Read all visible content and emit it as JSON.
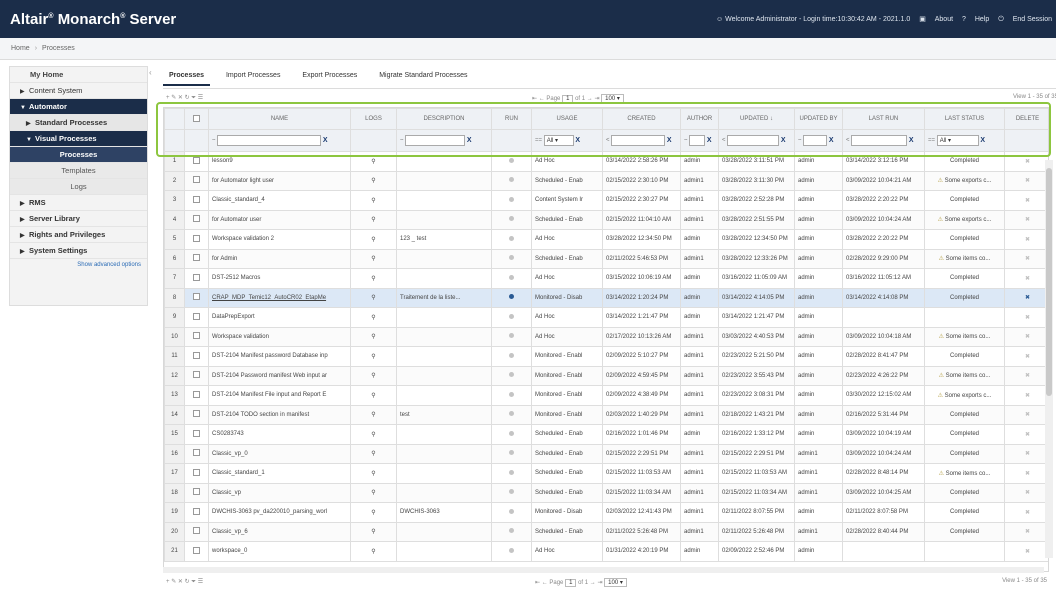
{
  "header": {
    "brand": "Altair",
    "brand_mark": "®",
    "brand_middle": "Monarch",
    "brand_tail": "Server",
    "welcome": "Welcome Administrator - Login time:10:30:42 AM - 2021.1.0",
    "about": "About",
    "help": "Help",
    "end_session": "End Session"
  },
  "breadcrumb": {
    "home": "Home",
    "current": "Processes"
  },
  "sidebar": {
    "home": "My Home",
    "content_system": "Content System",
    "automator": "Automator",
    "standard_processes": "Standard Processes",
    "visual_processes": "Visual Processes",
    "processes": "Processes",
    "templates": "Templates",
    "logs": "Logs",
    "rms": "RMS",
    "server_library": "Server Library",
    "rights": "Rights and Privileges",
    "system_settings": "System Settings",
    "advanced": "Show advanced options"
  },
  "tabs": {
    "processes": "Processes",
    "import": "Import Processes",
    "export": "Export Processes",
    "migrate": "Migrate Standard Processes"
  },
  "pager": {
    "page_label": "Page",
    "page": "1",
    "of": "of 1",
    "page_size": "100",
    "view": "View 1 - 35 of 35"
  },
  "columns": {
    "name": "NAME",
    "logs": "LOGS",
    "description": "DESCRIPTION",
    "run": "RUN",
    "usage": "USAGE",
    "created": "CREATED",
    "author": "AUTHOR",
    "updated": "UPDATED",
    "updated_by": "UPDATED BY",
    "last_run": "LAST RUN",
    "last_status": "LAST STATUS",
    "delete": "DELETE"
  },
  "filters": {
    "all": "All",
    "clear": "X",
    "op_tilde": "~",
    "op_eq": "==",
    "op_lt": "<"
  },
  "rows": [
    {
      "num": "1",
      "name": "lesson9",
      "desc": "",
      "usage": "Ad Hoc",
      "created": "03/14/2022 2:58:26 PM",
      "author": "admin",
      "updated": "03/28/2022 3:11:51 PM",
      "updated_by": "admin",
      "last_run": "03/14/2022 3:12:16 PM",
      "status": "Completed",
      "warn": false
    },
    {
      "num": "2",
      "name": "for Automator light user",
      "desc": "",
      "usage": "Scheduled - Enab",
      "created": "02/15/2022 2:30:10 PM",
      "author": "admin1",
      "updated": "03/28/2022 3:11:30 PM",
      "updated_by": "admin",
      "last_run": "03/09/2022 10:04:21 AM",
      "status": "Some exports c...",
      "warn": true
    },
    {
      "num": "3",
      "name": "Classic_standard_4",
      "desc": "",
      "usage": "Content System Ir",
      "created": "02/15/2022 2:30:27 PM",
      "author": "admin1",
      "updated": "03/28/2022 2:52:28 PM",
      "updated_by": "admin",
      "last_run": "03/28/2022 2:20:22 PM",
      "status": "Completed",
      "warn": false
    },
    {
      "num": "4",
      "name": "for Automator user",
      "desc": "",
      "usage": "Scheduled - Enab",
      "created": "02/15/2022 11:04:10 AM",
      "author": "admin1",
      "updated": "03/28/2022 2:51:55 PM",
      "updated_by": "admin",
      "last_run": "03/09/2022 10:04:24 AM",
      "status": "Some exports c...",
      "warn": true
    },
    {
      "num": "5",
      "name": "Workspace validation 2",
      "desc": "123 _ test",
      "usage": "Ad Hoc",
      "created": "03/28/2022 12:34:50 PM",
      "author": "admin",
      "updated": "03/28/2022 12:34:50 PM",
      "updated_by": "admin",
      "last_run": "03/28/2022 2:20:22 PM",
      "status": "Completed",
      "warn": false
    },
    {
      "num": "6",
      "name": "for Admin",
      "desc": "",
      "usage": "Scheduled - Enab",
      "created": "02/11/2022 5:46:53 PM",
      "author": "admin1",
      "updated": "03/28/2022 12:33:26 PM",
      "updated_by": "admin",
      "last_run": "02/28/2022 9:29:00 PM",
      "status": "Some items co...",
      "warn": true
    },
    {
      "num": "7",
      "name": "DST-2512 Macros",
      "desc": "",
      "usage": "Ad Hoc",
      "created": "03/15/2022 10:06:19 AM",
      "author": "admin",
      "updated": "03/16/2022 11:05:09 AM",
      "updated_by": "admin",
      "last_run": "03/16/2022 11:05:12 AM",
      "status": "Completed",
      "warn": false
    },
    {
      "num": "8",
      "name": "CRAP_MDP_Temic12_AutoCR02_EtapMe",
      "desc": "Traitement de la liste...",
      "usage": "Monitored - Disab",
      "created": "03/14/2022 1:20:24 PM",
      "author": "admin",
      "updated": "03/14/2022 4:14:05 PM",
      "updated_by": "admin",
      "last_run": "03/14/2022 4:14:08 PM",
      "status": "Completed",
      "warn": false,
      "selected": true
    },
    {
      "num": "9",
      "name": "DataPrepExport",
      "desc": "",
      "usage": "Ad Hoc",
      "created": "03/14/2022 1:21:47 PM",
      "author": "admin",
      "updated": "03/14/2022 1:21:47 PM",
      "updated_by": "admin",
      "last_run": "",
      "status": "",
      "warn": false
    },
    {
      "num": "10",
      "name": "Workspace validation",
      "desc": "",
      "usage": "Ad Hoc",
      "created": "02/17/2022 10:13:26 AM",
      "author": "admin1",
      "updated": "03/03/2022 4:40:53 PM",
      "updated_by": "admin",
      "last_run": "03/09/2022 10:04:18 AM",
      "status": "Some items co...",
      "warn": true
    },
    {
      "num": "11",
      "name": "DST-2104 Manifest password Database inp",
      "desc": "",
      "usage": "Monitored - Enabl",
      "created": "02/09/2022 5:10:27 PM",
      "author": "admin1",
      "updated": "02/23/2022 5:21:50 PM",
      "updated_by": "admin",
      "last_run": "02/28/2022 8:41:47 PM",
      "status": "Completed",
      "warn": false
    },
    {
      "num": "12",
      "name": "DST-2104 Password manifest Web input ar",
      "desc": "",
      "usage": "Monitored - Enabl",
      "created": "02/09/2022 4:59:45 PM",
      "author": "admin1",
      "updated": "02/23/2022 3:55:43 PM",
      "updated_by": "admin",
      "last_run": "02/23/2022 4:26:22 PM",
      "status": "Some items co...",
      "warn": true
    },
    {
      "num": "13",
      "name": "DST-2104 Manifest File input and Report E",
      "desc": "",
      "usage": "Monitored - Enabl",
      "created": "02/09/2022 4:38:49 PM",
      "author": "admin1",
      "updated": "02/23/2022 3:08:31 PM",
      "updated_by": "admin",
      "last_run": "03/30/2022 12:15:02 AM",
      "status": "Some exports c...",
      "warn": true
    },
    {
      "num": "14",
      "name": "DST-2104 TODO section in manifest",
      "desc": "test",
      "usage": "Monitored - Enabl",
      "created": "02/03/2022 1:40:29 PM",
      "author": "admin1",
      "updated": "02/18/2022 1:43:21 PM",
      "updated_by": "admin",
      "last_run": "02/16/2022 5:31:44 PM",
      "status": "Completed",
      "warn": false
    },
    {
      "num": "15",
      "name": "CS0283743",
      "desc": "",
      "usage": "Scheduled - Enab",
      "created": "02/16/2022 1:01:46 PM",
      "author": "admin",
      "updated": "02/16/2022 1:33:12 PM",
      "updated_by": "admin",
      "last_run": "03/09/2022 10:04:19 AM",
      "status": "Completed",
      "warn": false
    },
    {
      "num": "16",
      "name": "Classic_vp_0",
      "desc": "",
      "usage": "Scheduled - Enab",
      "created": "02/15/2022 2:29:51 PM",
      "author": "admin1",
      "updated": "02/15/2022 2:29:51 PM",
      "updated_by": "admin1",
      "last_run": "03/09/2022 10:04:24 AM",
      "status": "Completed",
      "warn": false
    },
    {
      "num": "17",
      "name": "Classic_standard_1",
      "desc": "",
      "usage": "Scheduled - Enab",
      "created": "02/15/2022 11:03:53 AM",
      "author": "admin1",
      "updated": "02/15/2022 11:03:53 AM",
      "updated_by": "admin1",
      "last_run": "02/28/2022 8:48:14 PM",
      "status": "Some items co...",
      "warn": true
    },
    {
      "num": "18",
      "name": "Classic_vp",
      "desc": "",
      "usage": "Scheduled - Enab",
      "created": "02/15/2022 11:03:34 AM",
      "author": "admin1",
      "updated": "02/15/2022 11:03:34 AM",
      "updated_by": "admin1",
      "last_run": "03/09/2022 10:04:25 AM",
      "status": "Completed",
      "warn": false
    },
    {
      "num": "19",
      "name": "DWCHIS-3063 pv_da220010_parsing_worl",
      "desc": "DWCHIS-3063",
      "usage": "Monitored - Disab",
      "created": "02/03/2022 12:41:43 PM",
      "author": "admin1",
      "updated": "02/11/2022 8:07:55 PM",
      "updated_by": "admin",
      "last_run": "02/11/2022 8:07:58 PM",
      "status": "Completed",
      "warn": false
    },
    {
      "num": "20",
      "name": "Classic_vp_6",
      "desc": "",
      "usage": "Scheduled - Enab",
      "created": "02/11/2022 5:26:48 PM",
      "author": "admin1",
      "updated": "02/11/2022 5:26:48 PM",
      "updated_by": "admin1",
      "last_run": "02/28/2022 8:40:44 PM",
      "status": "Completed",
      "warn": false
    },
    {
      "num": "21",
      "name": "workspace_0",
      "desc": "",
      "usage": "Ad Hoc",
      "created": "01/31/2022 4:20:19 PM",
      "author": "admin",
      "updated": "02/09/2022 2:52:46 PM",
      "updated_by": "admin",
      "last_run": "",
      "status": "",
      "warn": false
    }
  ]
}
